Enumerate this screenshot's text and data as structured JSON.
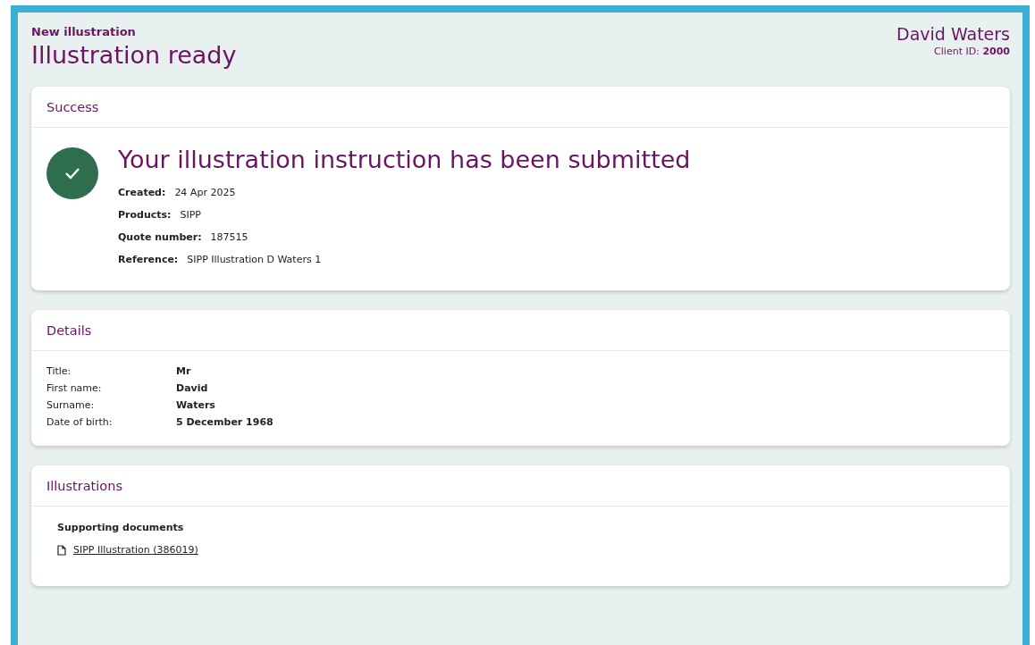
{
  "header": {
    "eyebrow": "New illustration",
    "title": "Illustration ready",
    "user_name": "David Waters",
    "client_id": "Client ID: **2000**"
  },
  "success": {
    "heading": "Success",
    "message": "Your illustration instruction has been submitted",
    "fields": [
      {
        "label": "Created:",
        "value": "24 Apr 2025"
      },
      {
        "label": "Products:",
        "value": "SIPP"
      },
      {
        "label": "Quote number:",
        "value": "187515"
      },
      {
        "label": "Reference:",
        "value": "SIPP Illustration D Waters 1"
      }
    ]
  },
  "details": {
    "heading": "Details",
    "fields": [
      {
        "label": "Title:",
        "value": "Mr"
      },
      {
        "label": "First name:",
        "value": "David"
      },
      {
        "label": "Surname:",
        "value": "Waters"
      },
      {
        "label": "Date of birth:",
        "value": "5 December 1968"
      }
    ]
  },
  "illustrations": {
    "heading": "Illustrations",
    "subheading": "Supporting documents",
    "documents": [
      {
        "label": "SIPP Illustration (386019)"
      }
    ]
  }
}
